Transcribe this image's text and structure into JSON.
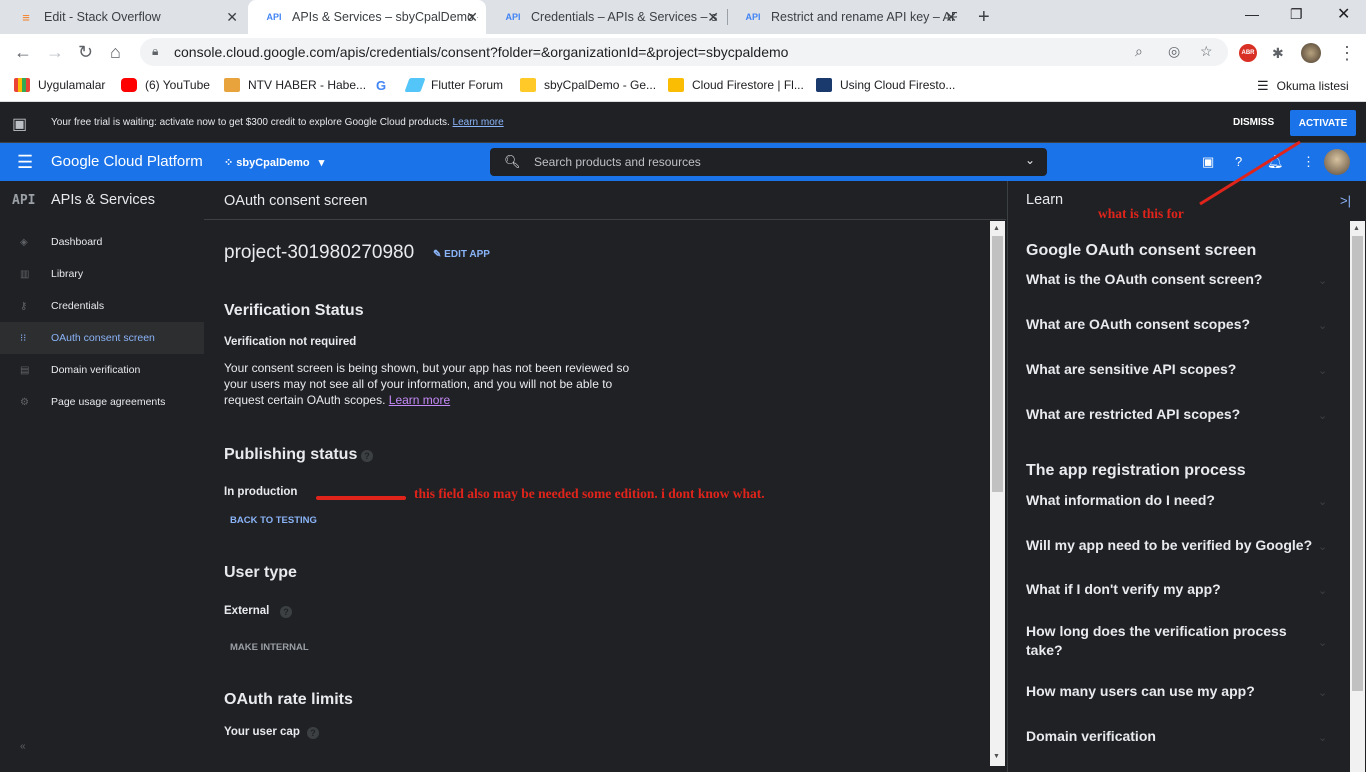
{
  "browser": {
    "tabs": [
      {
        "favicon": "stackoverflow-icon",
        "title": "Edit - Stack Overflow"
      },
      {
        "favicon": "API",
        "title": "APIs & Services – sbyCpalDemo –"
      },
      {
        "favicon": "API",
        "title": "Credentials – APIs & Services – sl"
      },
      {
        "favicon": "API",
        "title": "Restrict and rename API key – AP"
      }
    ],
    "url": "console.cloud.google.com/apis/credentials/consent?folder=&organizationId=&project=sbycpaldemo",
    "profile_badge": "ABR",
    "bookmarks": [
      {
        "label": "Uygulamalar",
        "icon": "apps-grid-icon",
        "color": "#ea4335"
      },
      {
        "label": "(6) YouTube",
        "icon": "youtube-icon",
        "color": "#ff0000"
      },
      {
        "label": "NTV HABER - Habe...",
        "icon": "ntv-icon",
        "color": "#e8a33d"
      },
      {
        "label": "",
        "icon": "google-icon",
        "color": "#4285f4"
      },
      {
        "label": "Flutter Forum",
        "icon": "flutter-icon",
        "color": "#54c5f8"
      },
      {
        "label": "sbyCpalDemo - Ge...",
        "icon": "firebase-icon",
        "color": "#ffca28"
      },
      {
        "label": "Cloud Firestore | Fl...",
        "icon": "cloud-icon",
        "color": "#fbbc04"
      },
      {
        "label": "Using Cloud Firesto...",
        "icon": "book-icon",
        "color": "#1a3a6e"
      }
    ],
    "reading_list": "Okuma listesi"
  },
  "trial": {
    "message": "Your free trial is waiting: activate now to get $300 credit to explore Google Cloud products.",
    "learn_more": "Learn more",
    "dismiss": "DISMISS",
    "activate": "ACTIVATE"
  },
  "gcp": {
    "brand": "Google Cloud Platform",
    "project": "sbyCpalDemo",
    "search_placeholder": "Search products and resources"
  },
  "sidebar": {
    "icon_text": "API",
    "title": "APIs & Services",
    "items": [
      {
        "label": "Dashboard",
        "icon": "dashboard-icon"
      },
      {
        "label": "Library",
        "icon": "library-icon"
      },
      {
        "label": "Credentials",
        "icon": "key-icon"
      },
      {
        "label": "OAuth consent screen",
        "icon": "consent-icon"
      },
      {
        "label": "Domain verification",
        "icon": "domain-icon"
      },
      {
        "label": "Page usage agreements",
        "icon": "settings-icon"
      }
    ],
    "selected_index": 3
  },
  "main": {
    "header": "OAuth consent screen",
    "project_name": "project-301980270980",
    "edit_app": "EDIT APP",
    "verification_title": "Verification Status",
    "verification_label": "Verification not required",
    "verification_text": "Your consent screen is being shown, but your app has not been reviewed so your users may not see all of your information, and you will not be able to request certain OAuth scopes.",
    "verification_link": "Learn more",
    "publishing_title": "Publishing status",
    "publishing_status": "In production",
    "back_to_testing": "BACK TO TESTING",
    "user_type_title": "User type",
    "user_type_value": "External",
    "make_internal": "MAKE INTERNAL",
    "rate_limits_title": "OAuth rate limits",
    "user_cap_label": "Your user cap"
  },
  "annotations": {
    "field_note": "this field also may be needed some edition. i dont know what.",
    "learn_note": "what is this for",
    "color": "#e0241b"
  },
  "learn": {
    "title": "Learn",
    "sections": [
      {
        "heading": "Google OAuth consent screen",
        "items": [
          "What is the OAuth consent screen?",
          "What are OAuth consent scopes?",
          "What are sensitive API scopes?",
          "What are restricted API scopes?"
        ]
      },
      {
        "heading": "The app registration process",
        "items": [
          "What information do I need?",
          "Will my app need to be verified by Google?",
          "What if I don't verify my app?",
          "How long does the verification process take?",
          "How many users can use my app?",
          "Domain verification"
        ]
      }
    ]
  }
}
